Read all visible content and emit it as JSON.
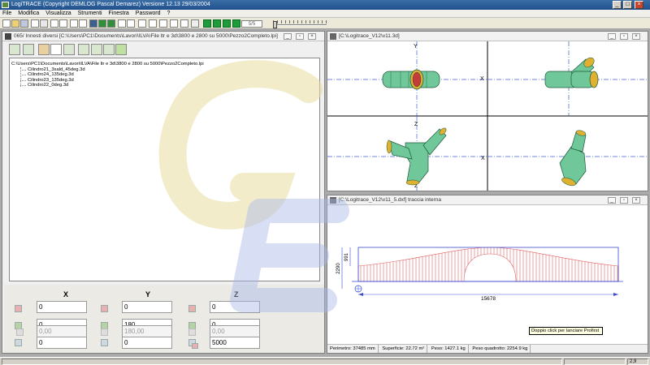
{
  "app": {
    "title": "LogiTRACE  (Copyright DEMLOG Pascal Demarez)  Versione 12.13 29/03/2004"
  },
  "menu": [
    "File",
    "Modifica",
    "Visualizza",
    "Strumenti",
    "Finestra",
    "Password",
    "?"
  ],
  "toolbar": {
    "frame_counter": "5/5"
  },
  "left_window": {
    "title": "065/ Innesti diversi  [C:\\Users\\PC1\\Documents\\Lavori\\ILVA\\File ltr e 3d\\3800 e 2800 su 5000\\Pezzo2Completo.lpi]",
    "tree": {
      "root": "C:\\Users\\PC1\\Documents\\Lavori\\ILVA\\File ltr e 3d\\3800 e 2800 su 5000\\Pezzo2Completo.lpi",
      "items": [
        "Cilindro21_3sald_45deg.3d",
        "Cilindro24_135deg.3d",
        "Cilindro23_135deg.3d",
        "Cilindro22_0deg.3d"
      ]
    },
    "coords": {
      "headers": [
        "X",
        "Y",
        "Z"
      ],
      "rows": [
        [
          "0",
          "0",
          "0"
        ],
        [
          "0",
          "180",
          "0"
        ],
        [
          "0",
          "0",
          "5000"
        ],
        [
          "0,00",
          "180,00",
          "0,00"
        ]
      ]
    }
  },
  "view3d": {
    "title": "[C:\\Logitrace_V12\\v11.3d]",
    "axis_labels": [
      "Y",
      "X",
      "Z",
      "X",
      "Z"
    ]
  },
  "dxf": {
    "title": "[C:\\Logitrace_V12\\v11_5.dxf]  traccia interna",
    "dim_height_small": "991",
    "dim_height_total": "2290",
    "dim_length": "15678",
    "tooltip": "Doppio click per lanciare Profirst",
    "status": [
      "Perimetro: 37485 mm",
      "Superficie: 22.72 m²",
      "Peso: 1427.1 kg",
      "Peso quadrotto: 2254.9 kg"
    ]
  },
  "statusbar": {
    "value": "2,9"
  },
  "colors": {
    "titlebar": "#2a5c98",
    "pipe": "#6fc79a",
    "pipe_edge": "#1d5a3a",
    "flange": "#e0b030",
    "dxf_lines": "#e06060",
    "dxf_outline": "#3a4ad0"
  }
}
